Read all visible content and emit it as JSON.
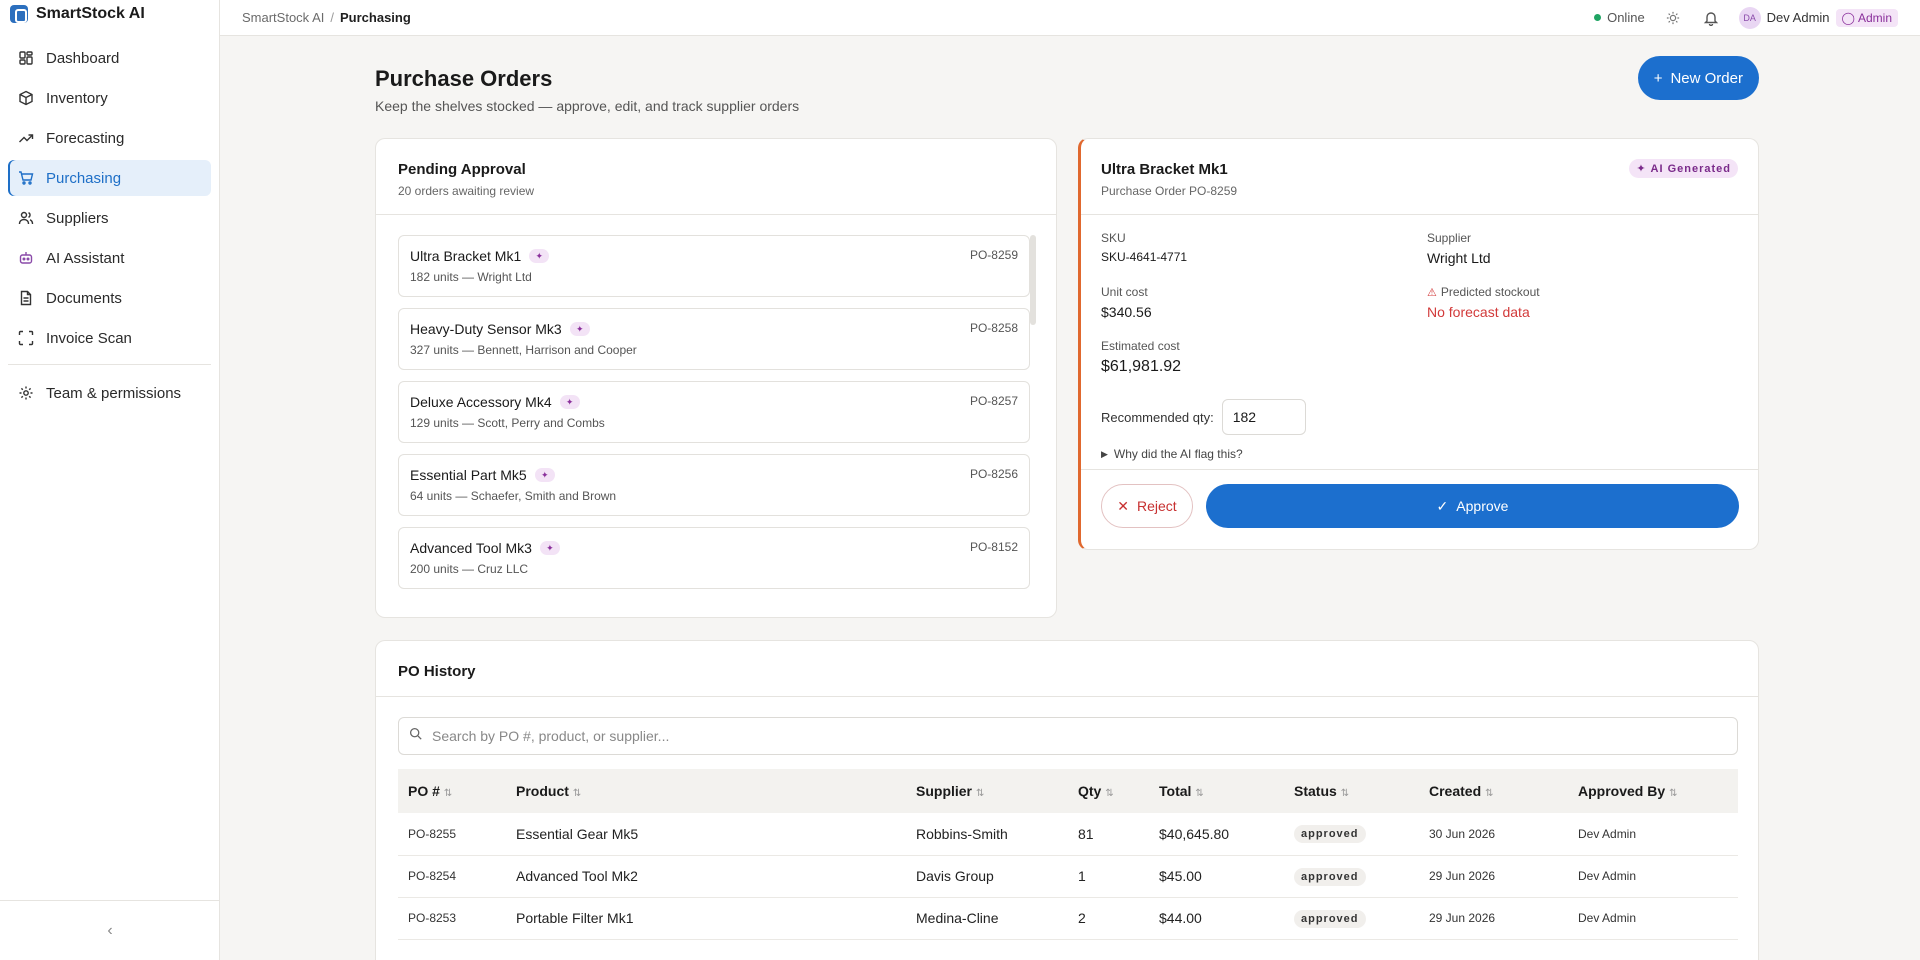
{
  "app": {
    "name": "SmartStock AI"
  },
  "sidebar": {
    "items": [
      {
        "label": "Dashboard",
        "icon": "dashboard-icon"
      },
      {
        "label": "Inventory",
        "icon": "box-icon"
      },
      {
        "label": "Forecasting",
        "icon": "trend-icon"
      },
      {
        "label": "Purchasing",
        "icon": "cart-icon",
        "active": true
      },
      {
        "label": "Suppliers",
        "icon": "users-icon"
      },
      {
        "label": "AI Assistant",
        "icon": "bot-icon"
      },
      {
        "label": "Documents",
        "icon": "document-icon"
      },
      {
        "label": "Invoice Scan",
        "icon": "scan-icon"
      }
    ],
    "secondary": [
      {
        "label": "Team & permissions",
        "icon": "gear-icon"
      }
    ],
    "collapse_icon": "chevron-left-icon"
  },
  "topbar": {
    "breadcrumb_root": "SmartStock AI",
    "breadcrumb_current": "Purchasing",
    "status": "Online",
    "user": {
      "initials": "DA",
      "name": "Dev Admin",
      "role": "Admin"
    }
  },
  "page": {
    "title": "Purchase Orders",
    "subtitle": "Keep the shelves stocked — approve, edit, and track supplier orders",
    "new_order_label": "New Order"
  },
  "pending": {
    "title": "Pending Approval",
    "subtitle": "20 orders awaiting review",
    "items": [
      {
        "name": "Ultra Bracket Mk1",
        "meta": "182 units — Wright Ltd",
        "po": "PO-8259"
      },
      {
        "name": "Heavy-Duty Sensor Mk3",
        "meta": "327 units — Bennett, Harrison and Cooper",
        "po": "PO-8258"
      },
      {
        "name": "Deluxe Accessory Mk4",
        "meta": "129 units — Scott, Perry and Combs",
        "po": "PO-8257"
      },
      {
        "name": "Essential Part Mk5",
        "meta": "64 units — Schaefer, Smith and Brown",
        "po": "PO-8256"
      },
      {
        "name": "Advanced Tool Mk3",
        "meta": "200 units — Cruz LLC",
        "po": "PO-8152"
      }
    ]
  },
  "detail": {
    "title": "Ultra Bracket Mk1",
    "subtitle": "Purchase Order PO-8259",
    "badge": "AI Generated",
    "sku_label": "SKU",
    "sku": "SKU-4641-4771",
    "supplier_label": "Supplier",
    "supplier": "Wright Ltd",
    "unit_cost_label": "Unit cost",
    "unit_cost": "$340.56",
    "stockout_label": "Predicted stockout",
    "stockout": "No forecast data",
    "est_cost_label": "Estimated cost",
    "est_cost": "$61,981.92",
    "qty_label": "Recommended qty:",
    "qty": "182",
    "why_label": "Why did the AI flag this?",
    "reject_label": "Reject",
    "approve_label": "Approve"
  },
  "history": {
    "title": "PO History",
    "search_placeholder": "Search by PO #, product, or supplier...",
    "columns": [
      "PO #",
      "Product",
      "Supplier",
      "Qty",
      "Total",
      "Status",
      "Created",
      "Approved By"
    ],
    "rows": [
      {
        "po": "PO-8255",
        "product": "Essential Gear Mk5",
        "supplier": "Robbins-Smith",
        "qty": "81",
        "total": "$40,645.80",
        "status": "approved",
        "created": "30 Jun 2026",
        "approved_by": "Dev Admin"
      },
      {
        "po": "PO-8254",
        "product": "Advanced Tool Mk2",
        "supplier": "Davis Group",
        "qty": "1",
        "total": "$45.00",
        "status": "approved",
        "created": "29 Jun 2026",
        "approved_by": "Dev Admin"
      },
      {
        "po": "PO-8253",
        "product": "Portable Filter Mk1",
        "supplier": "Medina-Cline",
        "qty": "2",
        "total": "$44.00",
        "status": "approved",
        "created": "29 Jun 2026",
        "approved_by": "Dev Admin"
      }
    ]
  },
  "colors": {
    "accent": "#1c6fce",
    "ai_badge": "#8a2f9b",
    "detail_border": "#e0682e",
    "danger": "#d23a3a",
    "online": "#1fa463"
  }
}
